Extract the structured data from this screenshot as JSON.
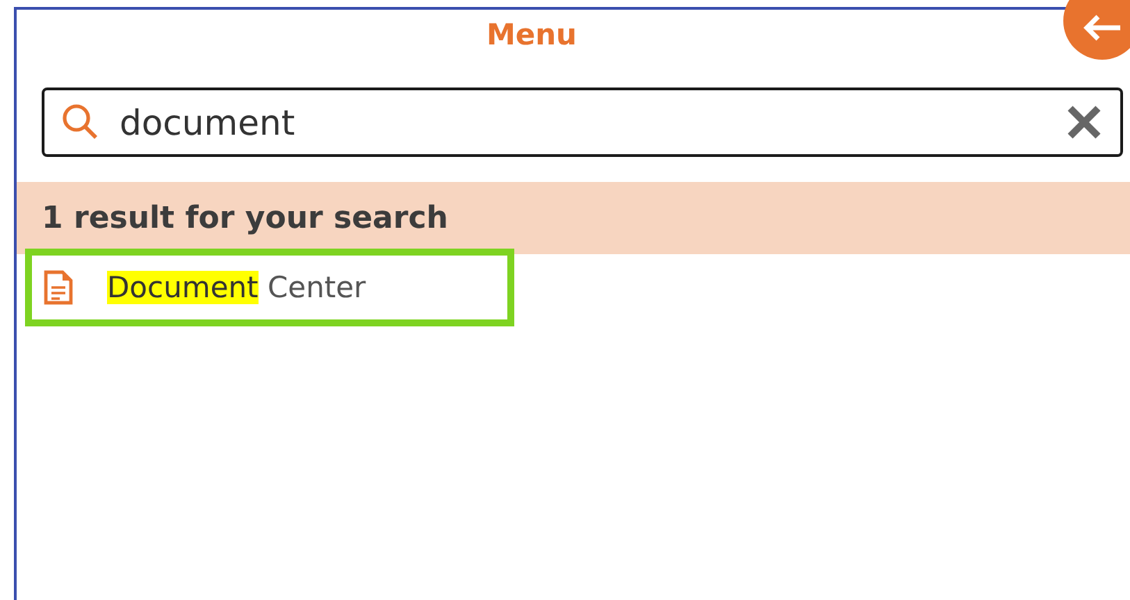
{
  "header": {
    "title": "Menu"
  },
  "search": {
    "value": "document"
  },
  "results_header": "1 result for your search",
  "results": [
    {
      "match": "Document",
      "rest": "Center",
      "selected": true
    }
  ]
}
